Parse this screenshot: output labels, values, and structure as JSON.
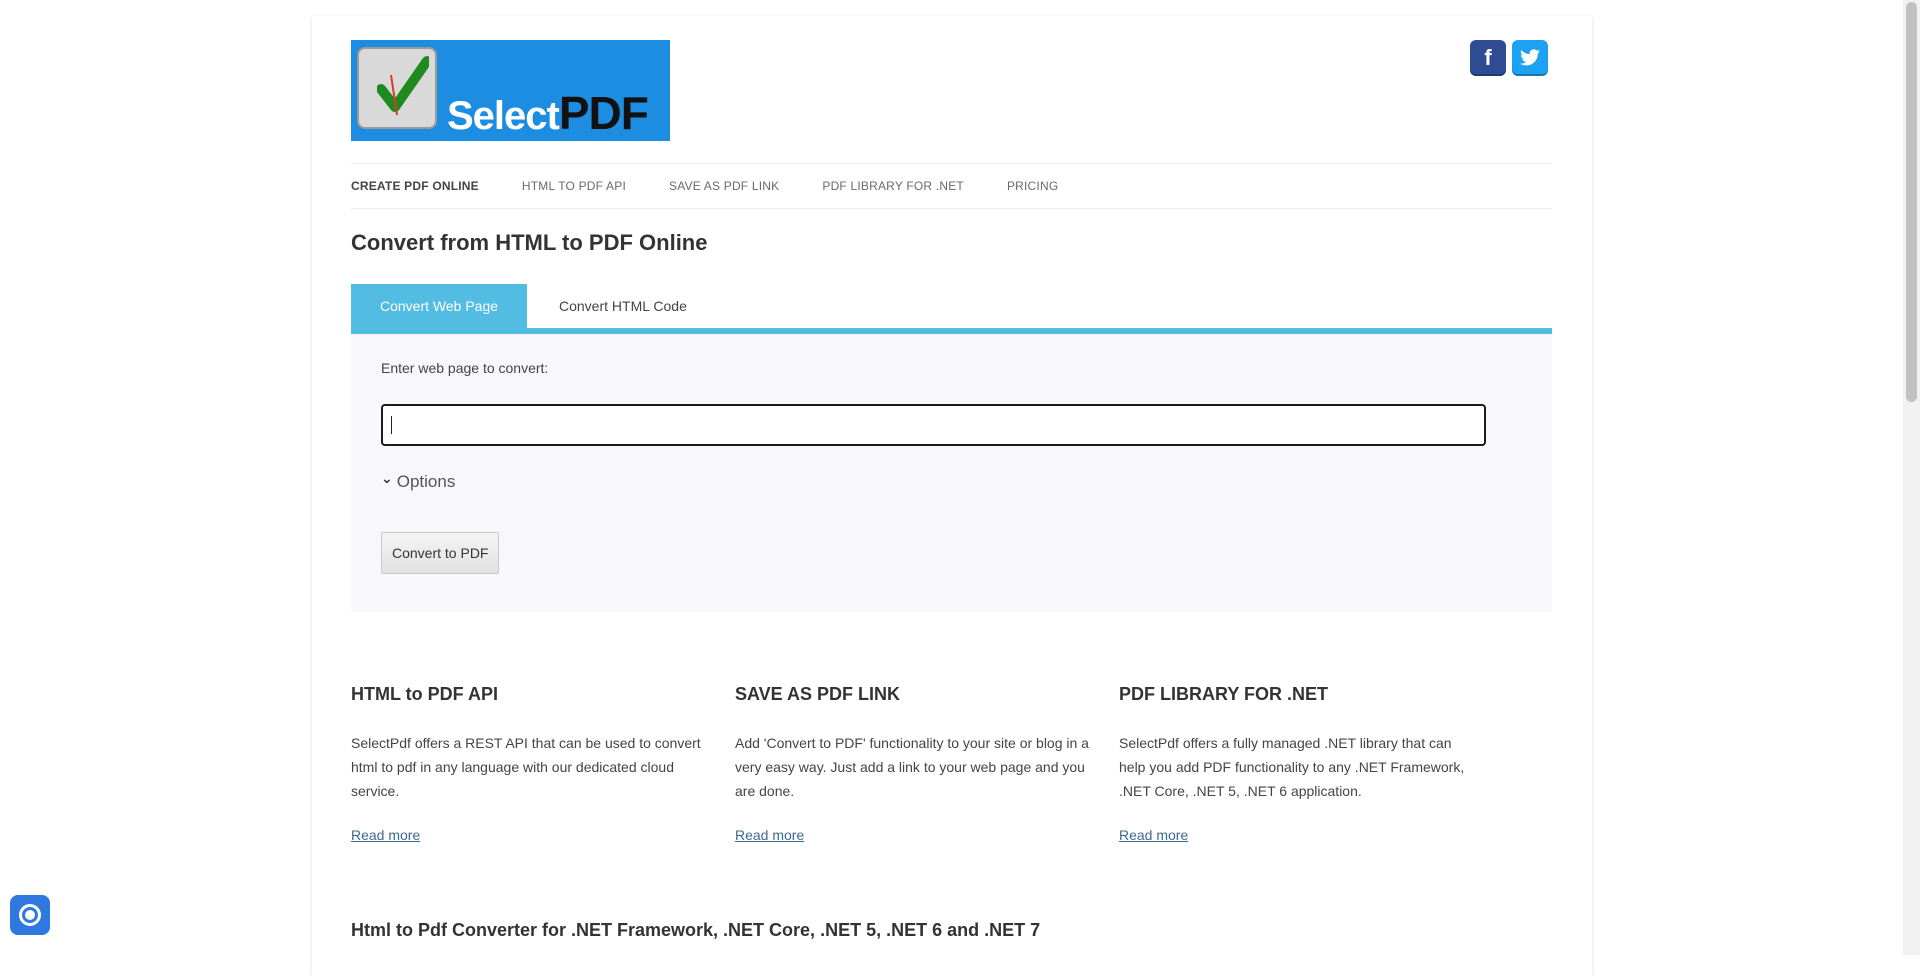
{
  "brand": {
    "logo_text_select": "Select",
    "logo_text_pdf": "PDF",
    "colors": {
      "logo_bg": "#1c8de0",
      "accent": "#52bce3",
      "facebook": "#2f4b94",
      "twitter": "#1da1f2"
    }
  },
  "social": {
    "facebook_icon": "facebook-icon",
    "twitter_icon": "twitter-icon"
  },
  "nav": {
    "items": [
      {
        "label": "CREATE PDF ONLINE",
        "active": true
      },
      {
        "label": "HTML TO PDF API"
      },
      {
        "label": "SAVE AS PDF LINK"
      },
      {
        "label": "PDF LIBRARY FOR .NET"
      },
      {
        "label": "PRICING"
      }
    ]
  },
  "main": {
    "title": "Convert from HTML to PDF Online",
    "tabs": [
      {
        "label": "Convert Web Page",
        "active": true
      },
      {
        "label": "Convert HTML Code"
      }
    ],
    "panel": {
      "input_label": "Enter web page to convert:",
      "input_value": "",
      "options_label": "Options",
      "convert_button": "Convert to PDF"
    }
  },
  "features": [
    {
      "title": "HTML to PDF API",
      "text": "SelectPdf offers a REST API that can be used to convert html to pdf in any language with our dedicated cloud service.",
      "link": "Read more"
    },
    {
      "title": "SAVE AS PDF LINK",
      "text": "Add 'Convert to PDF' functionality to your site or blog in a very easy way. Just add a link to your web page and you are done.",
      "link": "Read more"
    },
    {
      "title": "PDF LIBRARY FOR .NET",
      "text": "SelectPdf offers a fully managed .NET library that can help you add PDF functionality to any .NET Framework, .NET Core, .NET 5, .NET 6 application.",
      "link": "Read more"
    }
  ],
  "bottom_title": "Html to Pdf Converter for .NET Framework, .NET Core, .NET 5, .NET 6 and .NET 7"
}
